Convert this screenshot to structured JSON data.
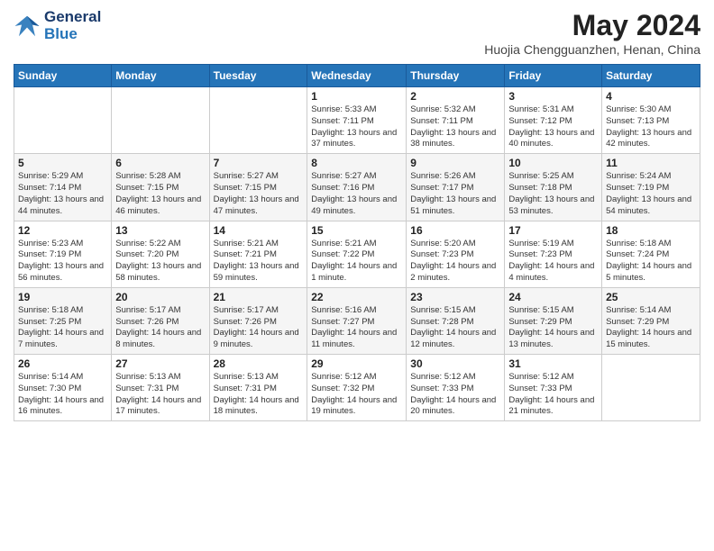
{
  "header": {
    "logo_line1": "General",
    "logo_line2": "Blue",
    "month": "May 2024",
    "location": "Huojia Chengguanzhen, Henan, China"
  },
  "days_of_week": [
    "Sunday",
    "Monday",
    "Tuesday",
    "Wednesday",
    "Thursday",
    "Friday",
    "Saturday"
  ],
  "weeks": [
    {
      "row_class": "row-white",
      "days": [
        {
          "num": "",
          "info": ""
        },
        {
          "num": "",
          "info": ""
        },
        {
          "num": "",
          "info": ""
        },
        {
          "num": "1",
          "info": "Sunrise: 5:33 AM\nSunset: 7:11 PM\nDaylight: 13 hours and 37 minutes."
        },
        {
          "num": "2",
          "info": "Sunrise: 5:32 AM\nSunset: 7:11 PM\nDaylight: 13 hours and 38 minutes."
        },
        {
          "num": "3",
          "info": "Sunrise: 5:31 AM\nSunset: 7:12 PM\nDaylight: 13 hours and 40 minutes."
        },
        {
          "num": "4",
          "info": "Sunrise: 5:30 AM\nSunset: 7:13 PM\nDaylight: 13 hours and 42 minutes."
        }
      ]
    },
    {
      "row_class": "row-gray",
      "days": [
        {
          "num": "5",
          "info": "Sunrise: 5:29 AM\nSunset: 7:14 PM\nDaylight: 13 hours and 44 minutes."
        },
        {
          "num": "6",
          "info": "Sunrise: 5:28 AM\nSunset: 7:15 PM\nDaylight: 13 hours and 46 minutes."
        },
        {
          "num": "7",
          "info": "Sunrise: 5:27 AM\nSunset: 7:15 PM\nDaylight: 13 hours and 47 minutes."
        },
        {
          "num": "8",
          "info": "Sunrise: 5:27 AM\nSunset: 7:16 PM\nDaylight: 13 hours and 49 minutes."
        },
        {
          "num": "9",
          "info": "Sunrise: 5:26 AM\nSunset: 7:17 PM\nDaylight: 13 hours and 51 minutes."
        },
        {
          "num": "10",
          "info": "Sunrise: 5:25 AM\nSunset: 7:18 PM\nDaylight: 13 hours and 53 minutes."
        },
        {
          "num": "11",
          "info": "Sunrise: 5:24 AM\nSunset: 7:19 PM\nDaylight: 13 hours and 54 minutes."
        }
      ]
    },
    {
      "row_class": "row-white",
      "days": [
        {
          "num": "12",
          "info": "Sunrise: 5:23 AM\nSunset: 7:19 PM\nDaylight: 13 hours and 56 minutes."
        },
        {
          "num": "13",
          "info": "Sunrise: 5:22 AM\nSunset: 7:20 PM\nDaylight: 13 hours and 58 minutes."
        },
        {
          "num": "14",
          "info": "Sunrise: 5:21 AM\nSunset: 7:21 PM\nDaylight: 13 hours and 59 minutes."
        },
        {
          "num": "15",
          "info": "Sunrise: 5:21 AM\nSunset: 7:22 PM\nDaylight: 14 hours and 1 minute."
        },
        {
          "num": "16",
          "info": "Sunrise: 5:20 AM\nSunset: 7:23 PM\nDaylight: 14 hours and 2 minutes."
        },
        {
          "num": "17",
          "info": "Sunrise: 5:19 AM\nSunset: 7:23 PM\nDaylight: 14 hours and 4 minutes."
        },
        {
          "num": "18",
          "info": "Sunrise: 5:18 AM\nSunset: 7:24 PM\nDaylight: 14 hours and 5 minutes."
        }
      ]
    },
    {
      "row_class": "row-gray",
      "days": [
        {
          "num": "19",
          "info": "Sunrise: 5:18 AM\nSunset: 7:25 PM\nDaylight: 14 hours and 7 minutes."
        },
        {
          "num": "20",
          "info": "Sunrise: 5:17 AM\nSunset: 7:26 PM\nDaylight: 14 hours and 8 minutes."
        },
        {
          "num": "21",
          "info": "Sunrise: 5:17 AM\nSunset: 7:26 PM\nDaylight: 14 hours and 9 minutes."
        },
        {
          "num": "22",
          "info": "Sunrise: 5:16 AM\nSunset: 7:27 PM\nDaylight: 14 hours and 11 minutes."
        },
        {
          "num": "23",
          "info": "Sunrise: 5:15 AM\nSunset: 7:28 PM\nDaylight: 14 hours and 12 minutes."
        },
        {
          "num": "24",
          "info": "Sunrise: 5:15 AM\nSunset: 7:29 PM\nDaylight: 14 hours and 13 minutes."
        },
        {
          "num": "25",
          "info": "Sunrise: 5:14 AM\nSunset: 7:29 PM\nDaylight: 14 hours and 15 minutes."
        }
      ]
    },
    {
      "row_class": "row-white",
      "days": [
        {
          "num": "26",
          "info": "Sunrise: 5:14 AM\nSunset: 7:30 PM\nDaylight: 14 hours and 16 minutes."
        },
        {
          "num": "27",
          "info": "Sunrise: 5:13 AM\nSunset: 7:31 PM\nDaylight: 14 hours and 17 minutes."
        },
        {
          "num": "28",
          "info": "Sunrise: 5:13 AM\nSunset: 7:31 PM\nDaylight: 14 hours and 18 minutes."
        },
        {
          "num": "29",
          "info": "Sunrise: 5:12 AM\nSunset: 7:32 PM\nDaylight: 14 hours and 19 minutes."
        },
        {
          "num": "30",
          "info": "Sunrise: 5:12 AM\nSunset: 7:33 PM\nDaylight: 14 hours and 20 minutes."
        },
        {
          "num": "31",
          "info": "Sunrise: 5:12 AM\nSunset: 7:33 PM\nDaylight: 14 hours and 21 minutes."
        },
        {
          "num": "",
          "info": ""
        }
      ]
    }
  ]
}
